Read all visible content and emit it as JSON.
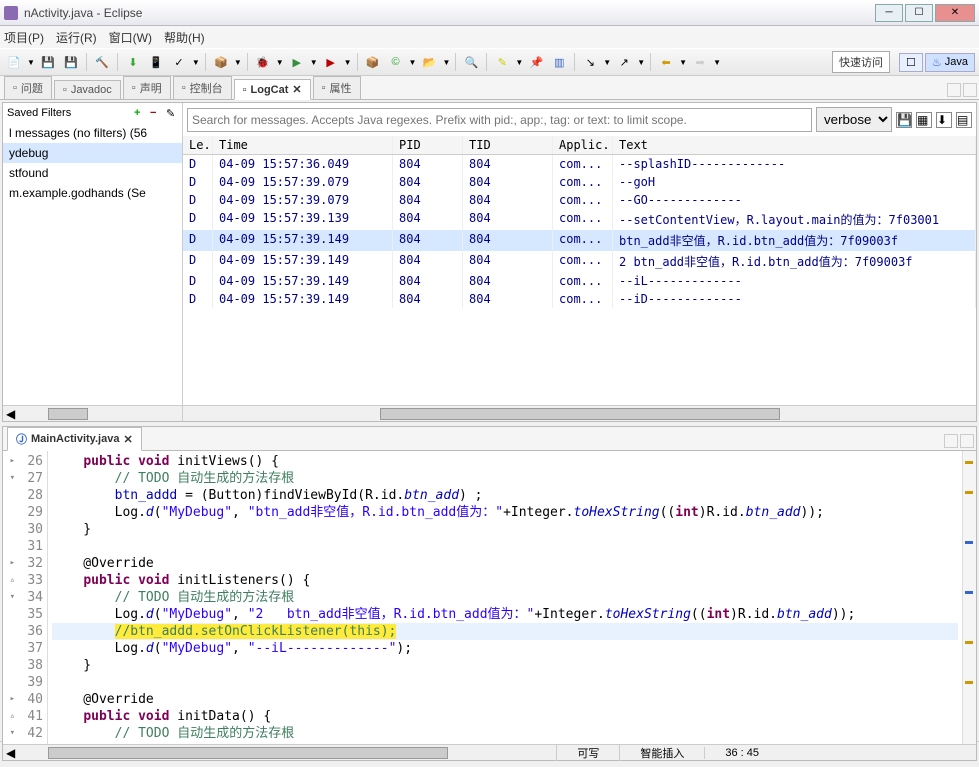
{
  "window": {
    "title": "nActivity.java - Eclipse"
  },
  "menu": [
    "项目(P)",
    "运行(R)",
    "窗口(W)",
    "帮助(H)"
  ],
  "quick_access": "快速访问",
  "perspective": "Java",
  "views": {
    "tabs": [
      {
        "icon": "problem",
        "label": "问题"
      },
      {
        "icon": "javadoc",
        "label": "Javadoc"
      },
      {
        "icon": "decl",
        "label": "声明"
      },
      {
        "icon": "console",
        "label": "控制台"
      },
      {
        "icon": "logcat",
        "label": "LogCat",
        "active": true
      },
      {
        "icon": "props",
        "label": "属性"
      }
    ]
  },
  "filters": {
    "header": "Saved Filters",
    "items": [
      "l messages (no filters) (56",
      "ydebug",
      "stfound",
      "m.example.godhands (Se"
    ],
    "selected": 1
  },
  "logcat": {
    "search_placeholder": "Search for messages. Accepts Java regexes. Prefix with pid:, app:, tag: or text: to limit scope.",
    "level": "verbose",
    "columns": [
      "Le...",
      "Time",
      "PID",
      "TID",
      "Applic...",
      "Text"
    ],
    "rows": [
      {
        "l": "D",
        "t": "04-09 15:57:36.049",
        "p": "804",
        "d": "804",
        "a": "com...",
        "x": "--splashID-------------"
      },
      {
        "l": "D",
        "t": "04-09 15:57:39.079",
        "p": "804",
        "d": "804",
        "a": "com...",
        "x": "--goH"
      },
      {
        "l": "D",
        "t": "04-09 15:57:39.079",
        "p": "804",
        "d": "804",
        "a": "com...",
        "x": "--GO-------------"
      },
      {
        "l": "D",
        "t": "04-09 15:57:39.139",
        "p": "804",
        "d": "804",
        "a": "com...",
        "x": "--setContentView，R.layout.main的值为：7f03001"
      },
      {
        "l": "D",
        "t": "04-09 15:57:39.149",
        "p": "804",
        "d": "804",
        "a": "com...",
        "x": "btn_add非空值，R.id.btn_add值为：7f09003f",
        "sel": true
      },
      {
        "l": "D",
        "t": "04-09 15:57:39.149",
        "p": "804",
        "d": "804",
        "a": "com...",
        "x": "2   btn_add非空值，R.id.btn_add值为：7f09003f"
      },
      {
        "l": "D",
        "t": "04-09 15:57:39.149",
        "p": "804",
        "d": "804",
        "a": "com...",
        "x": "--iL-------------"
      },
      {
        "l": "D",
        "t": "04-09 15:57:39.149",
        "p": "804",
        "d": "804",
        "a": "com...",
        "x": "--iD-------------"
      }
    ]
  },
  "editor": {
    "tab": "MainActivity.java",
    "lines": [
      {
        "n": 26,
        "m": "▸",
        "h": "<span class='kw'>public</span> <span class='kw'>void</span> initViews() {"
      },
      {
        "n": 27,
        "m": "▾",
        "h": "    <span class='cm'>// TODO 自动生成的方法存根</span>"
      },
      {
        "n": 28,
        "h": "    <span class='fld'>btn_addd</span> = (Button)findViewById(R.id.<span class='sfld'>btn_add</span>) ;"
      },
      {
        "n": 29,
        "h": "    Log.<span class='sfld'>d</span>(<span class='str'>\"MyDebug\"</span>, <span class='str'>\"btn_add非空值，R.id.btn_add值为：\"</span>+Integer.<span class='sfld'>toHexString</span>((<span class='kw'>int</span>)R.id.<span class='sfld'>btn_add</span>));"
      },
      {
        "n": 30,
        "h": "}"
      },
      {
        "n": 31,
        "h": ""
      },
      {
        "n": 32,
        "m": "▸",
        "h": "@Override"
      },
      {
        "n": 33,
        "m": "▵",
        "h": "<span class='kw'>public</span> <span class='kw'>void</span> initListeners() {"
      },
      {
        "n": 34,
        "m": "▾",
        "h": "    <span class='cm'>// TODO 自动生成的方法存根</span>"
      },
      {
        "n": 35,
        "h": "    Log.<span class='sfld'>d</span>(<span class='str'>\"MyDebug\"</span>, <span class='str'>\"2   btn_add非空值，R.id.btn_add值为：\"</span>+Integer.<span class='sfld'>toHexString</span>((<span class='kw'>int</span>)R.id.<span class='sfld'>btn_add</span>));"
      },
      {
        "n": 36,
        "curr": true,
        "h": "    <span class='hl'><span class='cm'>//btn_addd.setOnClickListener(this);</span></span>"
      },
      {
        "n": 37,
        "h": "    Log.<span class='sfld'>d</span>(<span class='str'>\"MyDebug\"</span>, <span class='str'>\"--iL-------------\"</span>);"
      },
      {
        "n": 38,
        "h": "}"
      },
      {
        "n": 39,
        "h": ""
      },
      {
        "n": 40,
        "m": "▸",
        "h": "@Override"
      },
      {
        "n": 41,
        "m": "▵",
        "h": "<span class='kw'>public</span> <span class='kw'>void</span> initData() {"
      },
      {
        "n": 42,
        "m": "▾",
        "h": "    <span class='cm'>// TODO 自动生成的方法存根</span>"
      }
    ]
  },
  "status": {
    "writable": "可写",
    "insert": "智能插入",
    "pos": "36 : 45"
  }
}
